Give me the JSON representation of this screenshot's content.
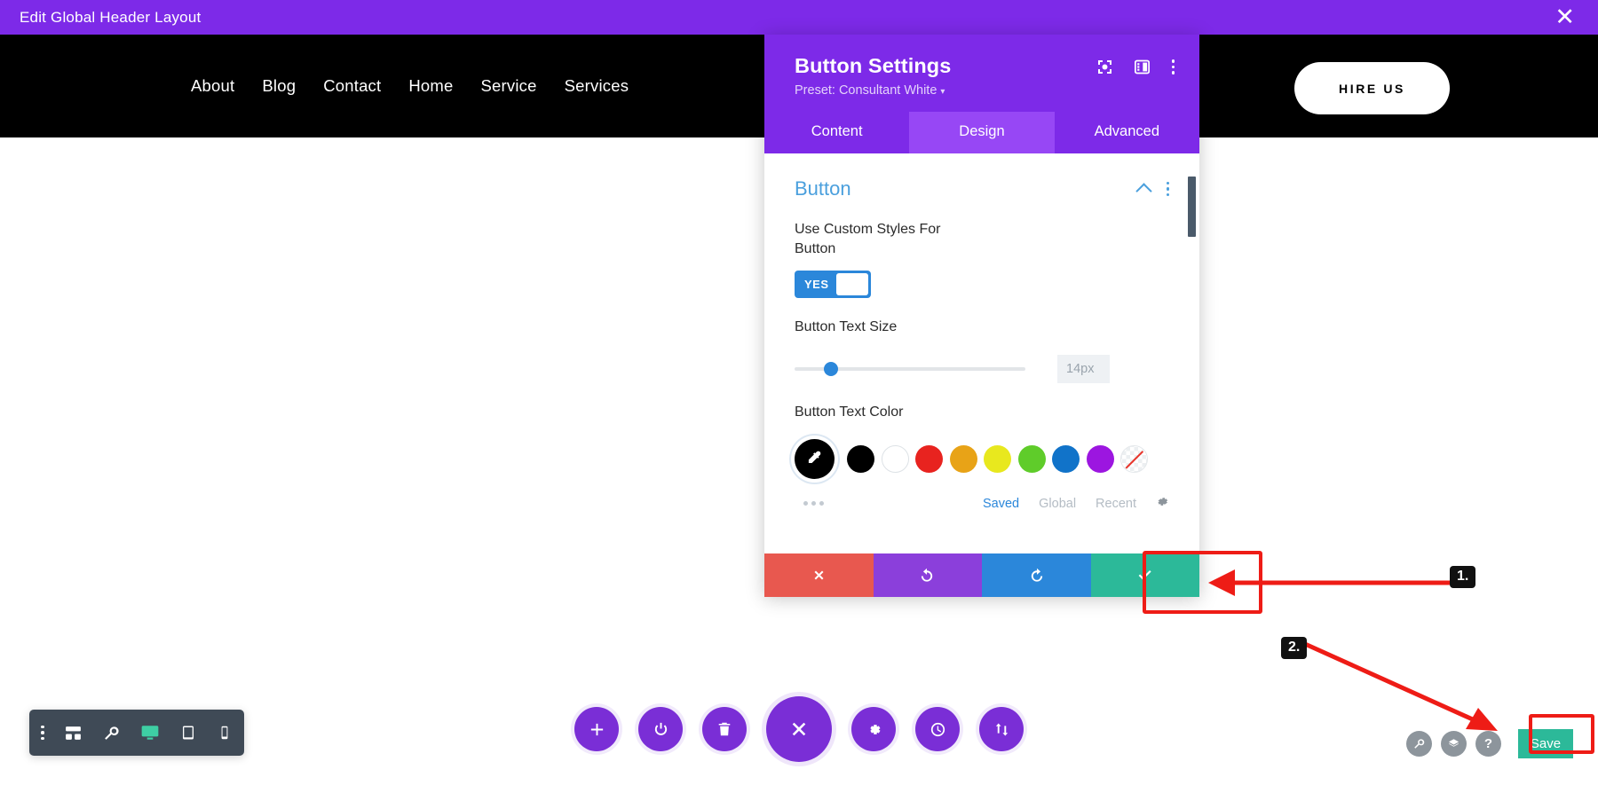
{
  "topbar": {
    "title": "Edit Global Header Layout",
    "close_icon": "close-icon"
  },
  "site_header": {
    "nav_items": [
      {
        "label": "About"
      },
      {
        "label": "Blog"
      },
      {
        "label": "Contact"
      },
      {
        "label": "Home"
      },
      {
        "label": "Service"
      },
      {
        "label": "Services"
      }
    ],
    "cta_label": "HIRE US"
  },
  "modal": {
    "title": "Button Settings",
    "preset": "Preset: Consultant White",
    "preset_caret": "▾",
    "header_icons": [
      {
        "name": "focus-target-icon"
      },
      {
        "name": "panel-layout-icon"
      },
      {
        "name": "more-options-icon"
      }
    ],
    "tabs": [
      {
        "label": "Content",
        "active": false
      },
      {
        "label": "Design",
        "active": true
      },
      {
        "label": "Advanced",
        "active": false
      }
    ],
    "section": {
      "title": "Button",
      "collapse_icon": "chevron-up-icon",
      "options_icon": "more-options-icon"
    },
    "fields": {
      "custom_styles_label": "Use Custom Styles For Button",
      "toggle_value": "YES",
      "text_size_label": "Button Text Size",
      "text_size_value": "14px",
      "text_color_label": "Button Text Color"
    },
    "swatches": [
      {
        "name": "eyedropper-swatch",
        "color": "#000000",
        "selected": true
      },
      {
        "name": "swatch-black",
        "color": "#000000"
      },
      {
        "name": "swatch-white",
        "color": "#ffffff"
      },
      {
        "name": "swatch-red",
        "color": "#e8231f"
      },
      {
        "name": "swatch-orange",
        "color": "#e8a317"
      },
      {
        "name": "swatch-yellow",
        "color": "#e8e81e"
      },
      {
        "name": "swatch-green",
        "color": "#5fcc2a"
      },
      {
        "name": "swatch-blue",
        "color": "#1173c9"
      },
      {
        "name": "swatch-purple",
        "color": "#9c16e0"
      },
      {
        "name": "swatch-transparent",
        "color": "transparent"
      }
    ],
    "swatch_tabs": [
      {
        "label": "Saved",
        "active": true
      },
      {
        "label": "Global",
        "active": false
      },
      {
        "label": "Recent",
        "active": false
      }
    ],
    "swatch_settings_icon": "gear-icon",
    "more_swatches_icon": "ellipsis-icon",
    "actions": [
      {
        "name": "cancel-button",
        "icon": "close-icon",
        "color": "#e8584f"
      },
      {
        "name": "undo-button",
        "icon": "undo-icon",
        "color": "#8b3fdb"
      },
      {
        "name": "redo-button",
        "icon": "redo-icon",
        "color": "#2b87da"
      },
      {
        "name": "save-changes-button",
        "icon": "check-icon",
        "color": "#2cb999"
      }
    ]
  },
  "annotations": [
    {
      "label": "1."
    },
    {
      "label": "2."
    }
  ],
  "bottom_left_toolbar": [
    {
      "name": "toolbar-more-icon"
    },
    {
      "name": "wireframe-view-icon"
    },
    {
      "name": "zoom-out-view-icon"
    },
    {
      "name": "desktop-view-icon",
      "active": true
    },
    {
      "name": "tablet-view-icon"
    },
    {
      "name": "phone-view-icon"
    }
  ],
  "center_toolbar": [
    {
      "name": "add-icon"
    },
    {
      "name": "power-icon"
    },
    {
      "name": "trash-icon"
    },
    {
      "name": "close-menu-icon"
    },
    {
      "name": "settings-gear-icon"
    },
    {
      "name": "history-clock-icon"
    },
    {
      "name": "portability-icon"
    }
  ],
  "bottom_right": {
    "icons": [
      {
        "name": "search-icon"
      },
      {
        "name": "layers-icon"
      },
      {
        "name": "help-icon",
        "glyph": "?"
      }
    ],
    "save_label": "Save"
  },
  "colors": {
    "accent_purple": "#7d2ae8",
    "tab_active": "#9747f5",
    "highlight_red": "#ee1c16",
    "save_green": "#2cb999",
    "toggle_blue": "#2b87da",
    "section_title_blue": "#4a9fdd"
  }
}
